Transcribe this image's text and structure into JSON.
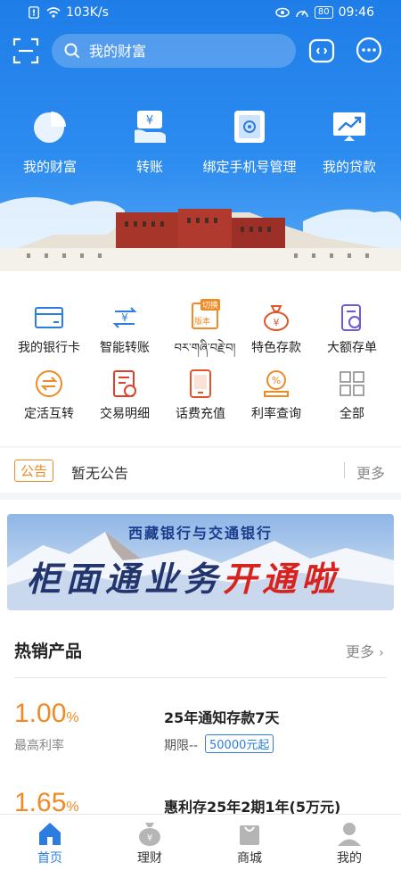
{
  "status": {
    "speed": "103K/s",
    "battery": "80",
    "time": "09:46"
  },
  "search": {
    "placeholder": "我的财富"
  },
  "quick": [
    {
      "label": "我的财富",
      "icon": "pie-chart-icon"
    },
    {
      "label": "转账",
      "icon": "transfer-yen-icon"
    },
    {
      "label": "绑定手机号管理",
      "icon": "phone-bind-icon"
    },
    {
      "label": "我的贷款",
      "icon": "loan-chart-icon"
    }
  ],
  "grid": [
    {
      "label": "我的银行卡",
      "icon": "bank-card-icon"
    },
    {
      "label": "智能转账",
      "icon": "smart-transfer-icon"
    },
    {
      "label": "བར་གཞི་བརྗེ་བ།",
      "icon": "version-switch-icon",
      "tag": "切换",
      "sub": "版本"
    },
    {
      "label": "特色存款",
      "icon": "money-bag-icon"
    },
    {
      "label": "大额存单",
      "icon": "deposit-certificate-icon"
    },
    {
      "label": "定活互转",
      "icon": "exchange-circle-icon"
    },
    {
      "label": "交易明细",
      "icon": "transaction-detail-icon"
    },
    {
      "label": "话费充值",
      "icon": "phone-recharge-icon"
    },
    {
      "label": "利率查询",
      "icon": "rate-query-icon"
    },
    {
      "label": "全部",
      "icon": "all-grid-icon"
    }
  ],
  "notice": {
    "badge": "公告",
    "text": "暂无公告",
    "more": "更多"
  },
  "ad": {
    "title": "西藏银行与交通银行",
    "line_left": "柜面通业务",
    "line_right": "开通啦"
  },
  "hot": {
    "title": "热销产品",
    "more": "更多",
    "products": [
      {
        "rate": "1.00",
        "pct": "%",
        "rate_label": "最高利率",
        "name": "25年通知存款7天",
        "term": "期限--",
        "start": "50000元起"
      },
      {
        "rate": "1.65",
        "pct": "%",
        "rate_label": "",
        "name": "惠利存25年2期1年(5万元)",
        "term": "",
        "start": ""
      }
    ]
  },
  "tabs": [
    {
      "label": "首页",
      "icon": "home-icon"
    },
    {
      "label": "理财",
      "icon": "wealth-bag-icon"
    },
    {
      "label": "商城",
      "icon": "shopping-bag-icon"
    },
    {
      "label": "我的",
      "icon": "user-icon"
    }
  ],
  "colors": {
    "primary": "#2d7de0",
    "accent": "#f08a24"
  }
}
